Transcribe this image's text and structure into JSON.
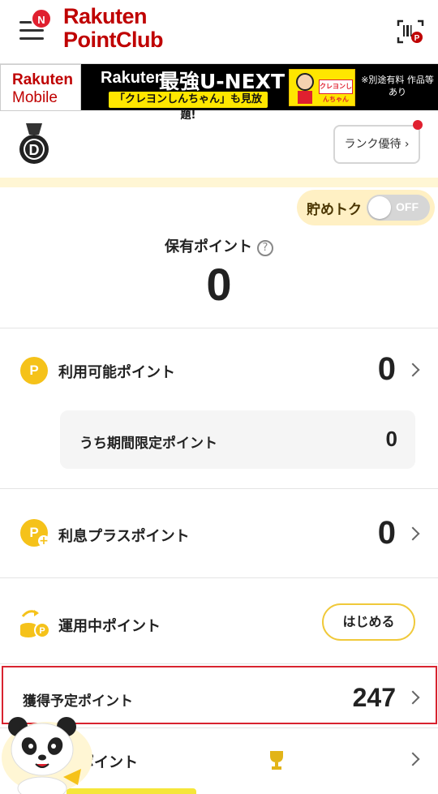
{
  "header": {
    "menu_badge": "N",
    "logo_line1": "Rakuten",
    "logo_line2": "PointClub"
  },
  "banner": {
    "mobile_line1": "Rakuten",
    "mobile_line2": "Mobile",
    "brand": "Rakuten",
    "title": "最強U-NEXT",
    "subtitle": "「クレヨンしんちゃん」も見放題!",
    "art_label": "クレヨンしんちゃん",
    "note": "※別途有料 作品等あり"
  },
  "rank": {
    "letter": "D",
    "button_label": "ランク優待"
  },
  "savings": {
    "label": "貯めトク",
    "toggle_state": "OFF"
  },
  "held_points": {
    "label": "保有ポイント",
    "help": "?",
    "value": "0"
  },
  "rows": {
    "available": {
      "icon": "P",
      "label": "利用可能ポイント",
      "value": "0"
    },
    "limited": {
      "label": "うち期間限定ポイント",
      "value": "0"
    },
    "interest": {
      "icon": "P",
      "label": "利息プラスポイント",
      "value": "0"
    },
    "investing": {
      "label": "運用中ポイント",
      "button": "はじめる"
    },
    "expected": {
      "label": "獲得予定ポイント",
      "value": "247"
    },
    "last": {
      "label": "ポイント"
    }
  },
  "colors": {
    "brand_red": "#bf0000",
    "point_yellow": "#f5c21a",
    "highlight_red": "#d8232f"
  }
}
